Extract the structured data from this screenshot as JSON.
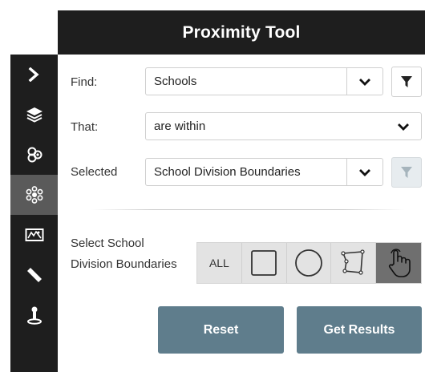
{
  "header": {
    "title": "Proximity Tool"
  },
  "rail": {
    "icons": [
      "chevron-right-icon",
      "layers-icon",
      "buffer-icon",
      "proximity-icon",
      "map-icon",
      "ruler-icon",
      "person-pin-icon"
    ],
    "active": "proximity-icon"
  },
  "form": {
    "find_label": "Find:",
    "find_value": "Schools",
    "that_label": "That:",
    "that_value": "are within",
    "selected_label": "Selected",
    "selected_value": "School Division Boundaries"
  },
  "selection": {
    "label": "Select School Division Boundaries",
    "tools": [
      "ALL",
      "rectangle-icon",
      "circle-icon",
      "polygon-icon",
      "hand-pointer-icon"
    ],
    "active_tool": "hand-pointer-icon"
  },
  "buttons": {
    "reset": "Reset",
    "get_results": "Get Results"
  },
  "colors": {
    "dark": "#1e1e1e",
    "button": "#5f7d8c",
    "active_tool": "#6f6f6f"
  }
}
